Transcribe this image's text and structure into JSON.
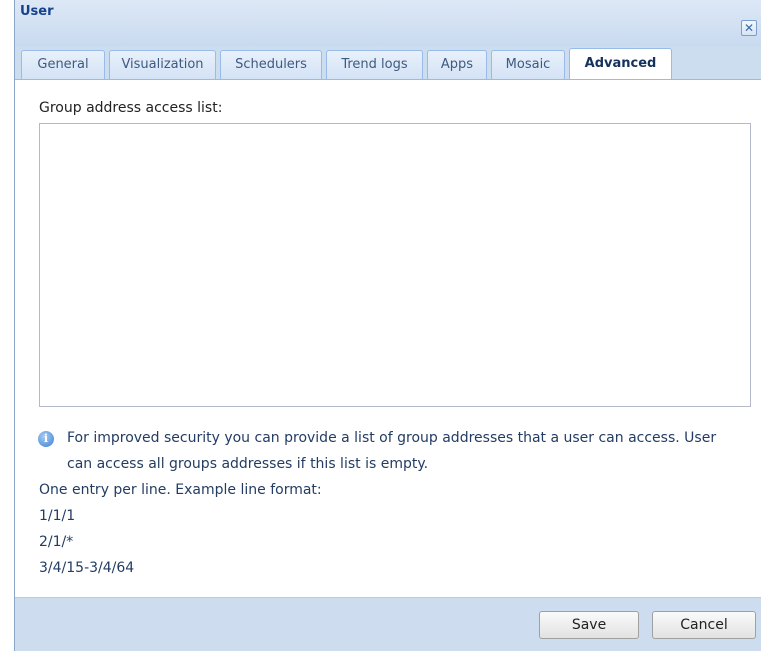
{
  "window": {
    "title": "User"
  },
  "tabs": [
    {
      "label": "General"
    },
    {
      "label": "Visualization"
    },
    {
      "label": "Schedulers"
    },
    {
      "label": "Trend logs"
    },
    {
      "label": "Apps"
    },
    {
      "label": "Mosaic"
    },
    {
      "label": "Advanced"
    }
  ],
  "active_tab": "Advanced",
  "form": {
    "group_access_label": "Group address access list:",
    "group_access_value": ""
  },
  "help": {
    "line1": "For improved security you can provide a list of group addresses that a user can access. User",
    "line2": "can access all groups addresses if this list is empty.",
    "line3": "One entry per line. Example line format:",
    "examples": [
      "1/1/1",
      "2/1/*",
      "3/4/15-3/4/64"
    ]
  },
  "buttons": {
    "save": "Save",
    "cancel": "Cancel"
  },
  "icons": {
    "close": "close-icon",
    "info": "info-icon"
  },
  "colors": {
    "title": "#15428b",
    "help_text": "#233c63",
    "tab_border": "#99bbe8"
  }
}
